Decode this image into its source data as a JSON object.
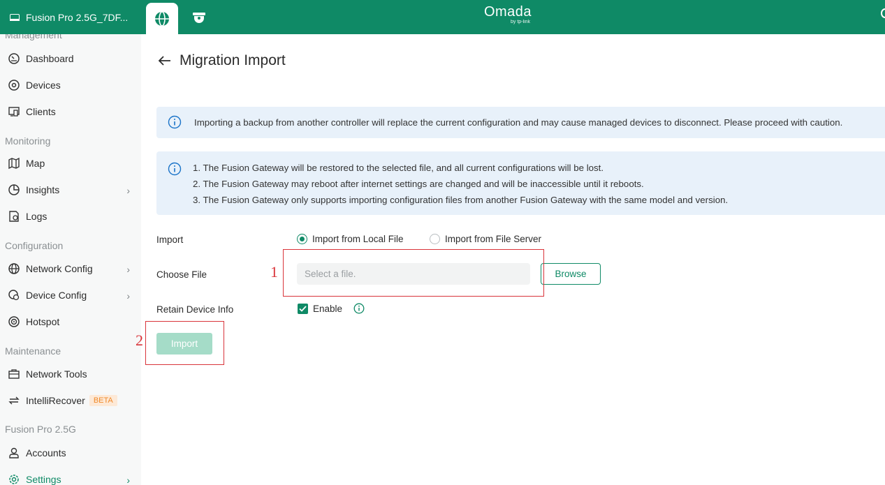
{
  "topbar": {
    "site_name": "Fusion Pro 2.5G_7DF...",
    "brand": "Omada",
    "brand_sub": "by tp-link"
  },
  "sidebar": {
    "truncated_section": "Management",
    "sections": {
      "monitoring": "Monitoring",
      "configuration": "Configuration",
      "maintenance": "Maintenance",
      "device": "Fusion Pro 2.5G"
    },
    "items": [
      {
        "label": "Dashboard",
        "icon": "dashboard-icon"
      },
      {
        "label": "Devices",
        "icon": "devices-icon"
      },
      {
        "label": "Clients",
        "icon": "clients-icon"
      },
      {
        "label": "Map",
        "icon": "map-icon"
      },
      {
        "label": "Insights",
        "icon": "insights-icon"
      },
      {
        "label": "Logs",
        "icon": "logs-icon"
      },
      {
        "label": "Network Config",
        "icon": "globe-icon"
      },
      {
        "label": "Device Config",
        "icon": "device-config-icon"
      },
      {
        "label": "Hotspot",
        "icon": "hotspot-icon"
      },
      {
        "label": "Network Tools",
        "icon": "toolbox-icon"
      },
      {
        "label": "IntelliRecover",
        "icon": "recover-icon",
        "badge": "BETA"
      },
      {
        "label": "Accounts",
        "icon": "user-icon"
      },
      {
        "label": "Settings",
        "icon": "gear-icon",
        "active": true
      }
    ]
  },
  "main": {
    "title": "Migration Import",
    "alert_warning": "Importing a backup from another controller will replace the current configuration and may cause managed devices to disconnect. Please proceed with caution.",
    "alert_notes": [
      "1. The Fusion Gateway will be restored to the selected file, and all current configurations will be lost.",
      "2. The Fusion Gateway may reboot after internet settings are changed and will be inaccessible until it reboots.",
      "3. The Fusion Gateway only supports importing configuration files from another Fusion Gateway with the same model and version."
    ],
    "form": {
      "import_label": "Import",
      "radio_local": "Import from Local File",
      "radio_server": "Import from File Server",
      "selected_source": "local",
      "choose_file_label": "Choose File",
      "file_placeholder": "Select a file.",
      "file_value": "",
      "browse": "Browse",
      "retain_label": "Retain Device Info",
      "enable_label": "Enable",
      "enable_checked": true,
      "import_button": "Import"
    },
    "annotations": [
      "1",
      "2"
    ]
  },
  "colors": {
    "brand_green": "#0f8a66",
    "alert_bg": "#e8f1fa",
    "annotation_red": "#d9343a",
    "disabled_button": "#a5dcc8"
  }
}
